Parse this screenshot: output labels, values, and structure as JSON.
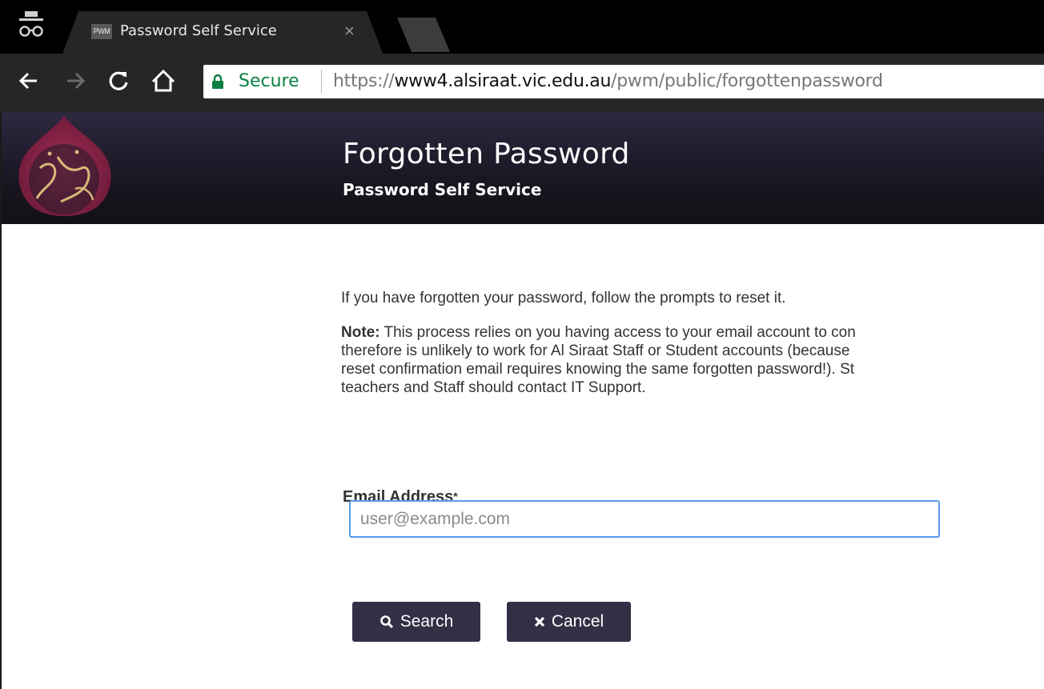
{
  "browser": {
    "tab_favicon_text": "PWM",
    "tab_title": "Password Self Service",
    "tab_close": "×",
    "secure_label": "Secure",
    "url": {
      "scheme": "https://",
      "host": "www4.alsiraat.vic.edu.au",
      "path": "/pwm/public/forgottenpassword"
    },
    "icons": [
      "incognito-icon",
      "back-icon",
      "forward-icon",
      "reload-icon",
      "home-icon",
      "lock-icon"
    ]
  },
  "header": {
    "title": "Forgotten Password",
    "subtitle": "Password Self Service"
  },
  "content": {
    "intro": "If you have forgotten your password, follow the prompts to reset it.",
    "note_label": "Note:",
    "note_lines": [
      " This process relies on you having access to your email account to con",
      "therefore is unlikely to work for Al Siraat Staff or Student accounts (because",
      "reset confirmation email requires knowing the same forgotten password!). St",
      "teachers and Staff should contact IT Support."
    ]
  },
  "form": {
    "email_label": "Email Address",
    "required_marker": "*",
    "email_placeholder": "user@example.com",
    "email_value": ""
  },
  "buttons": {
    "search": "Search",
    "cancel": "Cancel"
  },
  "colors": {
    "header_bg": "#1a1622",
    "button_bg": "#352f46",
    "input_focus_border": "#5b9ae6",
    "secure_green": "#0b8043",
    "logo_crimson": "#9e2a4e"
  }
}
